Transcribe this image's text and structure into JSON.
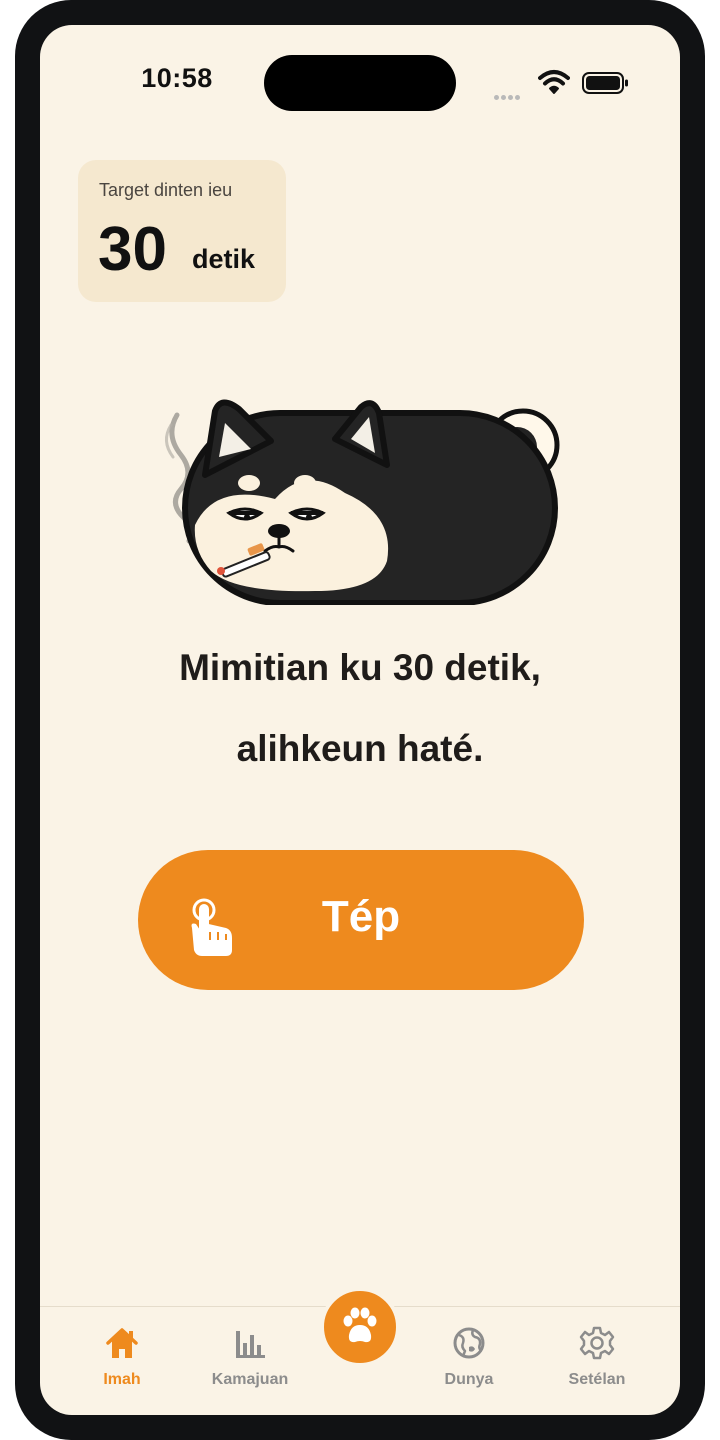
{
  "status_bar": {
    "time": "10:58",
    "icons": [
      "signal-icon",
      "wifi-icon",
      "battery-icon"
    ]
  },
  "target_card": {
    "label": "Target dinten ieu",
    "value": "30",
    "unit": "detik"
  },
  "illustration": {
    "icon": "smoking-shiba-dog"
  },
  "headline": {
    "line1": "Mimitian ku 30 detik,",
    "line2": "alihkeun haté."
  },
  "tap_button": {
    "label": "Tép",
    "icon": "tap-hand-icon"
  },
  "tab_bar": {
    "items": [
      {
        "label": "Imah",
        "icon": "home-icon",
        "active": true
      },
      {
        "label": "Kamajuan",
        "icon": "bar-chart-icon",
        "active": false
      },
      {
        "label": "",
        "icon": "paw-icon",
        "active": false
      },
      {
        "label": "Dunya",
        "icon": "globe-icon",
        "active": false
      },
      {
        "label": "Setélan",
        "icon": "gear-icon",
        "active": false
      }
    ]
  },
  "colors": {
    "background": "#faf3e6",
    "accent": "#ee8a1e",
    "card": "#f5e8cf",
    "text": "#1f1c1a",
    "inactive": "#8c8c8c"
  }
}
